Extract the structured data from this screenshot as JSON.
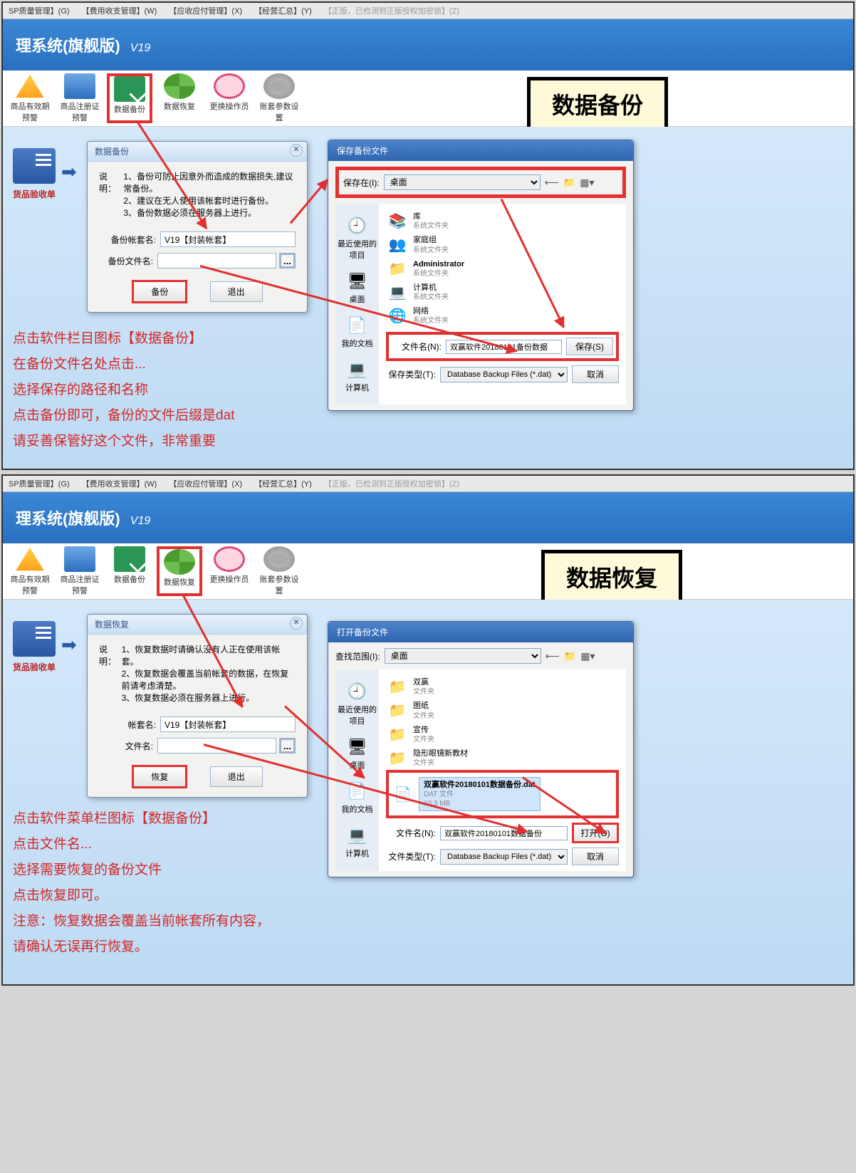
{
  "menubar": {
    "items": [
      "SP质量管理】(G)",
      "【费用收支管理】(W)",
      "【应收应付管理】(X)",
      "【经营汇总】(Y)",
      "【正版，已检测到正版授权加密锁】(Z)"
    ]
  },
  "header": {
    "title": "理系统(旗舰版)",
    "version": "V19"
  },
  "toolbar": {
    "btns": [
      "商品有效期预警",
      "商品注册证预警",
      "数据备份",
      "数据恢复",
      "更换操作员",
      "账套参数设置"
    ]
  },
  "side": {
    "label": "货品验收单"
  },
  "backup": {
    "bigtitle": "数据备份",
    "dlgtitle": "数据备份",
    "desc_label": "说明：",
    "desc": [
      "1、备份可防止因意外而造成的数据损失,建议常备份。",
      "2、建议在无人使用该帐套时进行备份。",
      "3、备份数据必须在服务器上进行。"
    ],
    "f1label": "备份帐套名:",
    "f1val": "V19【封装帐套】",
    "f2label": "备份文件名:",
    "f2val": "",
    "btn1": "备份",
    "btn2": "退出",
    "save": {
      "title": "保存备份文件",
      "loc_label": "保存在(I):",
      "loc_val": "桌面",
      "nav": [
        "最近使用的项目",
        "桌面",
        "我的文档",
        "计算机"
      ],
      "items": [
        {
          "name": "库",
          "sub": "系统文件夹"
        },
        {
          "name": "家庭组",
          "sub": "系统文件夹"
        },
        {
          "name": "Administrator",
          "sub": "系统文件夹"
        },
        {
          "name": "计算机",
          "sub": "系统文件夹"
        },
        {
          "name": "网络",
          "sub": "系统文件夹"
        }
      ],
      "fn_label": "文件名(N):",
      "fn_val": "双赢软件20180101备份数据",
      "ft_label": "保存类型(T):",
      "ft_val": "Database Backup Files (*.dat)",
      "b1": "保存(S)",
      "b2": "取消"
    },
    "instr": [
      "点击软件栏目图标【数据备份】",
      "在备份文件名处点击...",
      "选择保存的路径和名称",
      "点击备份即可，备份的文件后缀是dat",
      "请妥善保管好这个文件，非常重要"
    ]
  },
  "restore": {
    "bigtitle": "数据恢复",
    "dlgtitle": "数据恢复",
    "desc_label": "说明：",
    "desc": [
      "1、恢复数据时请确认没有人正在使用该帐套。",
      "2、恢复数据会覆盖当前帐套的数据，在恢复前请考虑清楚。",
      "3、恢复数据必须在服务器上进行。"
    ],
    "f1label": "帐套名:",
    "f1val": "V19【封装帐套】",
    "f2label": "文件名:",
    "f2val": "",
    "btn1": "恢复",
    "btn2": "退出",
    "open": {
      "title": "打开备份文件",
      "loc_label": "查找范围(I):",
      "loc_val": "桌面",
      "nav": [
        "最近使用的项目",
        "桌面",
        "我的文档",
        "计算机"
      ],
      "items": [
        {
          "name": "双赢",
          "sub": "文件夹"
        },
        {
          "name": "图纸",
          "sub": "文件夹"
        },
        {
          "name": "宣传",
          "sub": "文件夹"
        },
        {
          "name": "隐形眼镜新教材",
          "sub": "文件夹"
        }
      ],
      "sel": {
        "name": "双赢软件20180101数据备份.dat",
        "sub": "DAT 文件",
        "size": "10.3 MB"
      },
      "fn_label": "文件名(N):",
      "fn_val": "双赢软件20180101数据备份",
      "ft_label": "文件类型(T):",
      "ft_val": "Database Backup Files (*.dat)",
      "b1": "打开(O)",
      "b2": "取消"
    },
    "instr": [
      "点击软件菜单栏图标【数据备份】",
      "点击文件名...",
      "选择需要恢复的备份文件",
      "点击恢复即可。",
      "注意：恢复数据会覆盖当前帐套所有内容，",
      "请确认无误再行恢复。"
    ]
  }
}
